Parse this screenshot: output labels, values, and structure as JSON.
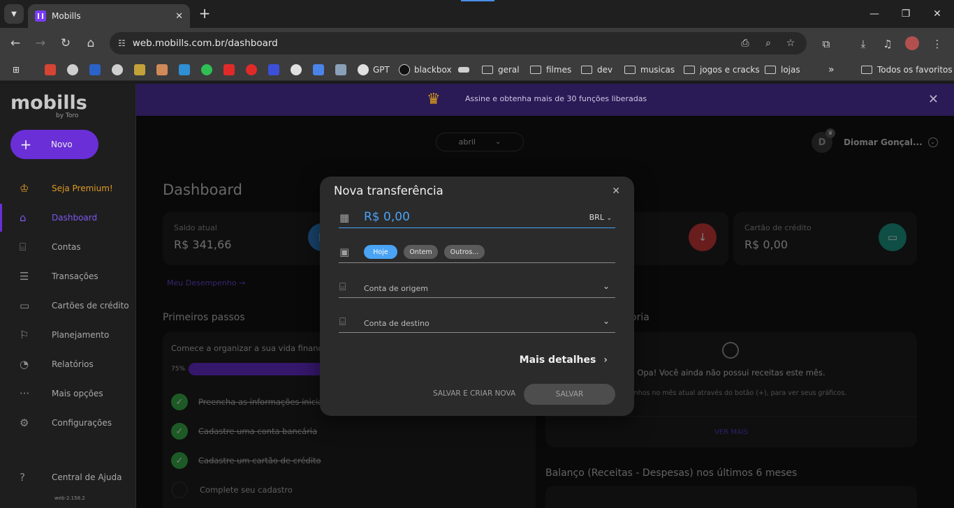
{
  "browser": {
    "tab_title": "Mobills",
    "url": "web.mobills.com.br/dashboard",
    "bookmarks": [
      "GPT",
      "blackbox",
      "geral",
      "filmes",
      "dev",
      "musicas",
      "jogos e cracks",
      "lojas"
    ],
    "all_bookmarks": "Todos os favoritos"
  },
  "app": {
    "logo": "mobills",
    "logo_sub": "by Toro",
    "new_button": "Novo",
    "banner": "Assine e obtenha mais de 30 funções liberadas",
    "sidebar": [
      {
        "label": "Seja Premium!",
        "icon": "crown-icon"
      },
      {
        "label": "Dashboard",
        "icon": "home-icon"
      },
      {
        "label": "Contas",
        "icon": "bank-icon"
      },
      {
        "label": "Transações",
        "icon": "list-icon"
      },
      {
        "label": "Cartões de crédito",
        "icon": "card-icon"
      },
      {
        "label": "Planejamento",
        "icon": "flag-icon"
      },
      {
        "label": "Relatórios",
        "icon": "pie-icon"
      },
      {
        "label": "Mais opções",
        "icon": "more-icon"
      },
      {
        "label": "Configurações",
        "icon": "gear-icon"
      },
      {
        "label": "Central de Ajuda",
        "icon": "help-icon"
      }
    ],
    "version": "web-2.158.2",
    "month": "abril",
    "user_initial": "D",
    "user_name": "Diomar Gonçal...",
    "page_title": "Dashboard",
    "cards": {
      "saldo_label": "Saldo atual",
      "saldo_value": "R$ 341,66",
      "credito_label": "Cartão de crédito",
      "credito_value": "R$ 0,00"
    },
    "performance_link": "Meu Desempenho",
    "first_steps_title": "Primeiros passos",
    "first_steps_intro": "Comece a organizar a sua vida financeira",
    "progress_text": "75%",
    "progress": 0.75,
    "steps": [
      {
        "label": "Preencha as informações iniciais",
        "done": true
      },
      {
        "label": "Cadastre uma conta bancária",
        "done": true
      },
      {
        "label": "Cadastre um cartão de crédito",
        "done": true
      },
      {
        "label": "Complete seu cadastro",
        "done": false
      }
    ],
    "category_title_fragment": "oria",
    "empty_title": "Opa! Você ainda não possui receitas este mês.",
    "empty_sub": "us ganhos no mês atual através do botão (+), para ver seus gráficos.",
    "see_more": "VER MAIS",
    "balance_title": "Balanço (Receitas - Despesas) nos últimos 6 meses"
  },
  "modal": {
    "title": "Nova transferência",
    "amount": "R$ 0,00",
    "currency": "BRL",
    "date_chips": [
      "Hoje",
      "Ontem",
      "Outros..."
    ],
    "origin": "Conta de origem",
    "destination": "Conta de destino",
    "more_details": "Mais detalhes",
    "save_new": "SALVAR E CRIAR NOVA",
    "save": "SALVAR"
  }
}
